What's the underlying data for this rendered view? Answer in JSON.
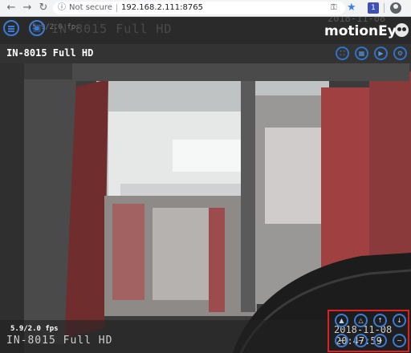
{
  "browser": {
    "back_icon": "arrow-left-icon",
    "forward_icon": "arrow-right-icon",
    "reload_icon": "reload-icon",
    "security_text": "Not secure",
    "url": "192.168.2.111:8765",
    "extension_label": "1"
  },
  "app": {
    "brand": "motionEye",
    "ghost_fps": "5.9/2.0 fps",
    "ghost_title": "IN-8015 Full HD",
    "ghost_clock": "2018-11-08"
  },
  "camera": {
    "title": "IN-8015 Full HD",
    "actions": [
      "fullscreen-icon",
      "media-browser-icon",
      "play-icon",
      "settings-icon"
    ]
  },
  "overlay": {
    "fps": "5.9/2.0 fps",
    "name": "IN-8015 Full HD",
    "date": "2018-11-08",
    "time": "20:47:59"
  },
  "ptz": {
    "highlight_color": "#e02020",
    "buttons": [
      "preset-up-icon",
      "preset-triangle-icon",
      "tilt-up-icon",
      "tilt-down-icon",
      "pan-left-icon",
      "pan-right-icon",
      "zoom-in-icon",
      "zoom-out-icon"
    ]
  },
  "colors": {
    "accent": "#3a7bd5",
    "chrome_bg": "#f1f3f4",
    "app_bg": "#1e1e1e"
  }
}
